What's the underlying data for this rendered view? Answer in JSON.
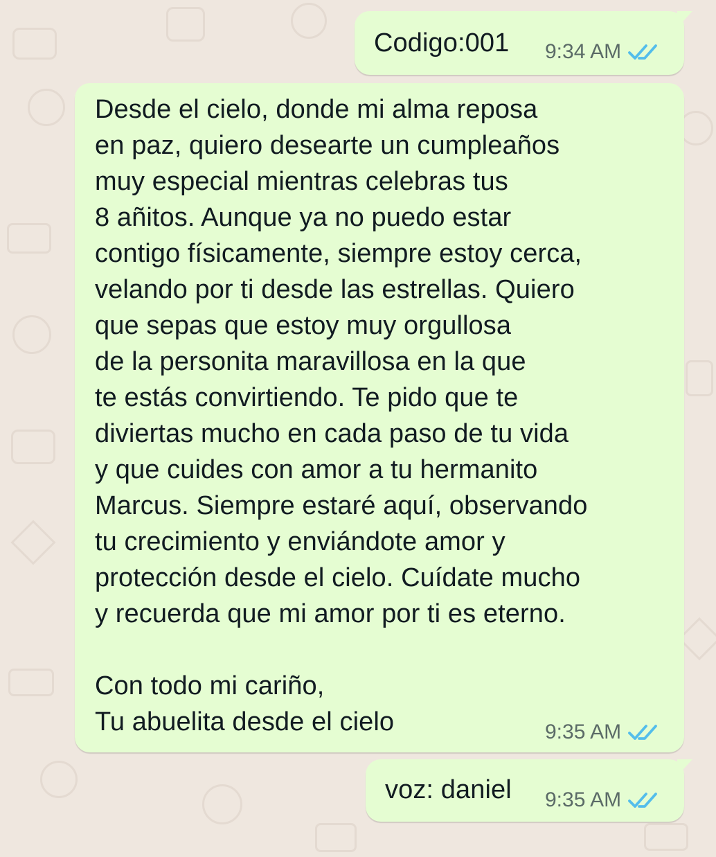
{
  "messages": [
    {
      "text": "Codigo:001",
      "time": "9:34 AM",
      "status": "read"
    },
    {
      "lines": [
        "Desde el cielo, donde mi alma reposa",
        "en paz, quiero desearte un cumpleaños",
        "muy especial mientras celebras tus",
        "8 añitos. Aunque ya no puedo estar",
        "contigo físicamente, siempre estoy cerca,",
        "velando por ti desde las estrellas. Quiero",
        "que sepas que estoy muy orgullosa",
        "de la personita maravillosa en la que",
        "te estás convirtiendo. Te pido que te",
        "diviertas mucho en cada paso de tu vida",
        "y que cuides con amor a tu hermanito",
        "Marcus. Siempre estaré aquí, observando",
        "tu crecimiento y enviándote amor y",
        "protección desde el cielo. Cuídate mucho",
        "y recuerda que mi amor por ti es eterno.",
        "",
        "Con todo mi cariño,",
        "Tu abuelita desde el cielo"
      ],
      "time": "9:35 AM",
      "status": "read"
    },
    {
      "text": "voz: daniel",
      "time": "9:35 AM",
      "status": "read"
    }
  ],
  "colors": {
    "background": "#efe7df",
    "outgoing_bubble": "#e5fdd2",
    "read_check": "#53bdeb",
    "meta_text": "#5b6b67"
  },
  "icons": {
    "status": "double-check-read-icon"
  }
}
